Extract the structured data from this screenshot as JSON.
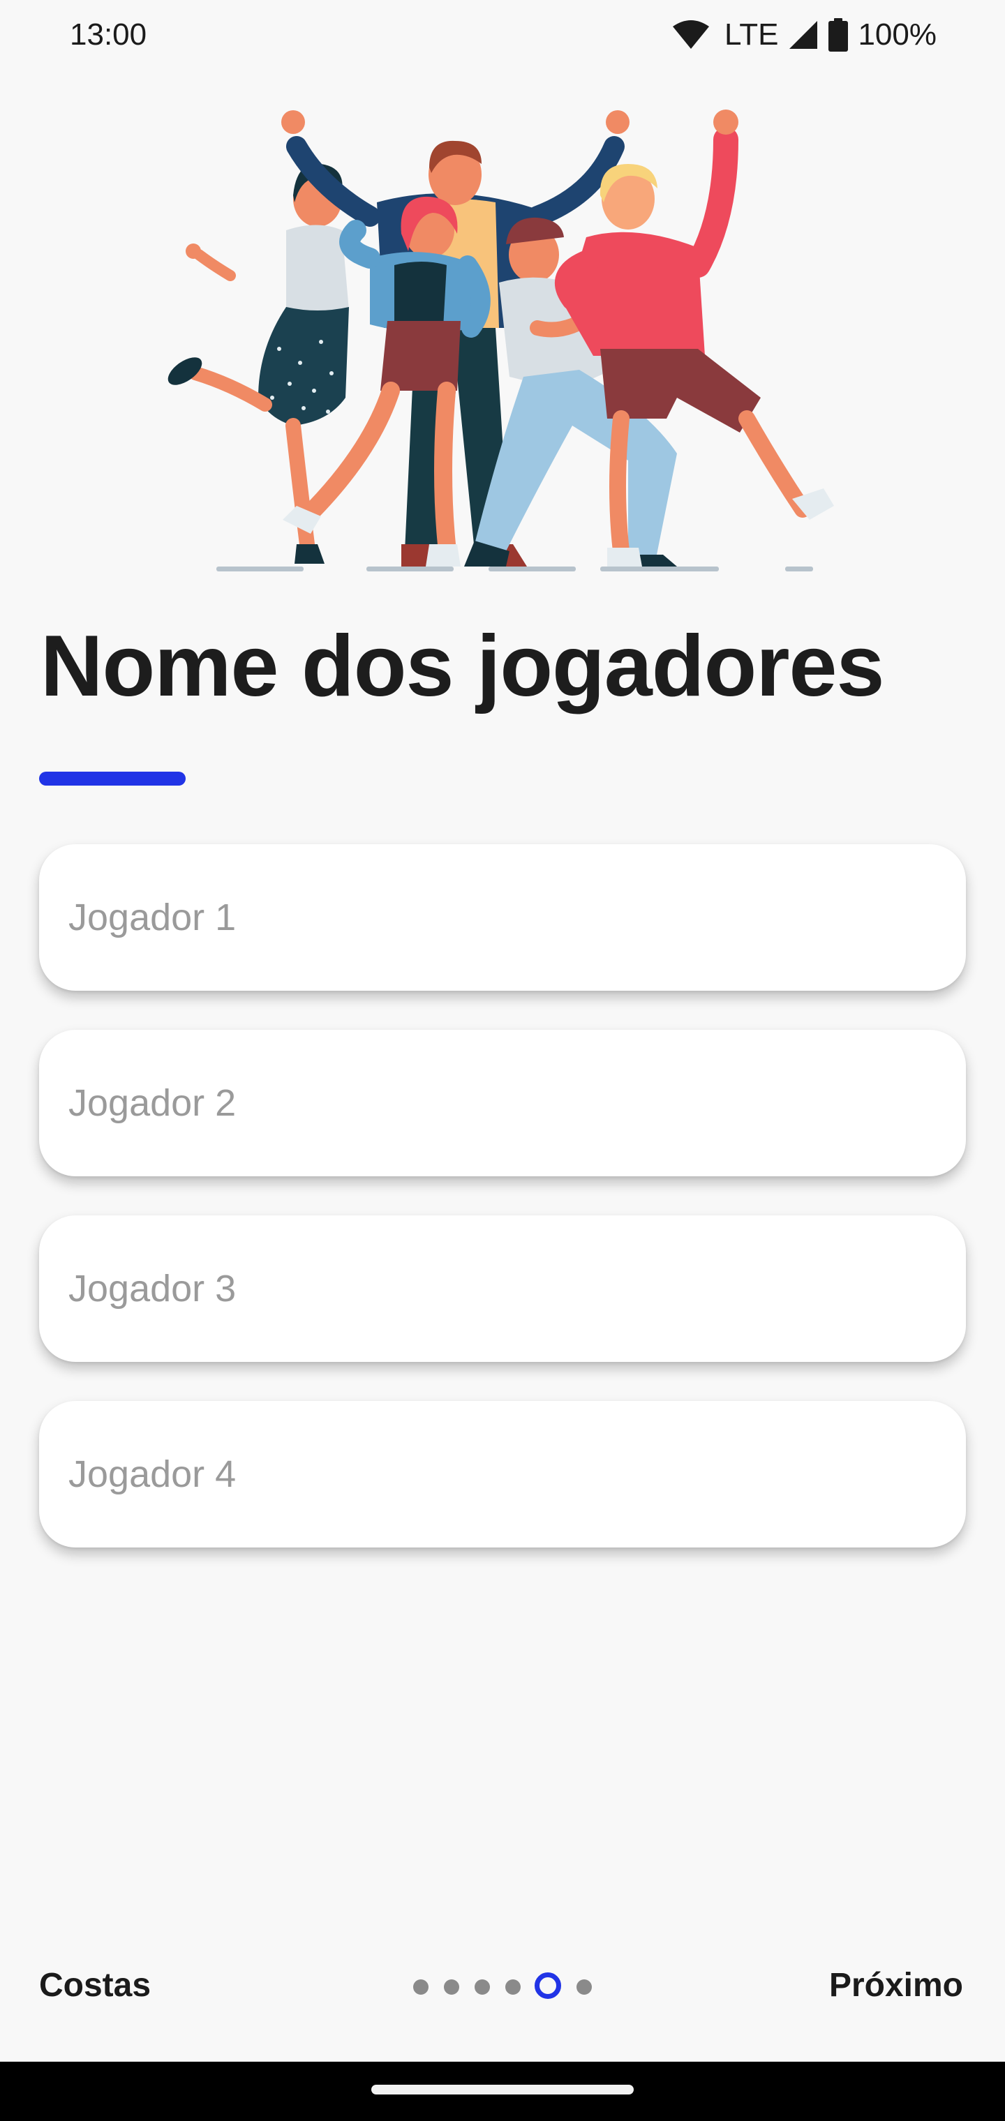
{
  "status_bar": {
    "time": "13:00",
    "network": "LTE",
    "battery": "100%",
    "icons": [
      "wifi-icon",
      "signal-icon",
      "battery-icon"
    ]
  },
  "illustration": {
    "name": "group-of-friends-illustration"
  },
  "page": {
    "title": "Nome dos jogadores",
    "accent_color": "#2134e6"
  },
  "players": [
    {
      "placeholder": "Jogador 1",
      "value": ""
    },
    {
      "placeholder": "Jogador 2",
      "value": ""
    },
    {
      "placeholder": "Jogador 3",
      "value": ""
    },
    {
      "placeholder": "Jogador 4",
      "value": ""
    }
  ],
  "navigation": {
    "back_label": "Costas",
    "next_label": "Próximo",
    "page_count": 6,
    "current_page": 5
  }
}
